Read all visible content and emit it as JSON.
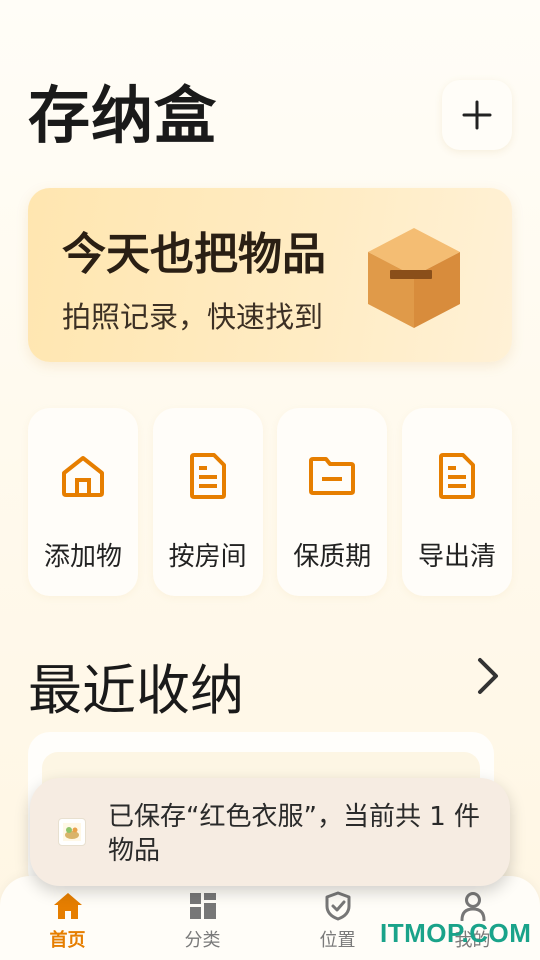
{
  "header": {
    "title": "存纳盒",
    "add_label": "+"
  },
  "hero": {
    "title": "今天也把物品",
    "subtitle": "拍照记录，快速找到",
    "icon": "box-icon"
  },
  "quick_actions": [
    {
      "label": "添加物",
      "icon": "home-icon"
    },
    {
      "label": "按房间",
      "icon": "document-icon"
    },
    {
      "label": "保质期",
      "icon": "folder-icon"
    },
    {
      "label": "导出清",
      "icon": "document-icon"
    }
  ],
  "recent": {
    "title": "最近收纳",
    "arrow_icon": "chevron-right-icon"
  },
  "toast": {
    "message": "已保存“红色衣服”，当前共 1 件物品",
    "icon": "thumbnail-icon"
  },
  "tabbar": {
    "items": [
      {
        "label": "首页",
        "icon": "home-icon",
        "active": true
      },
      {
        "label": "分类",
        "icon": "grid-icon",
        "active": false
      },
      {
        "label": "位置",
        "icon": "shield-check-icon",
        "active": false
      },
      {
        "label": "我的",
        "icon": "person-icon",
        "active": false
      }
    ]
  },
  "watermark": {
    "text": "ITMOP.COM"
  },
  "colors": {
    "accent": "#e67e00",
    "hero_bg": "#ffe6b0",
    "background": "#fff8e8",
    "toast_bg": "#f6ece2"
  }
}
